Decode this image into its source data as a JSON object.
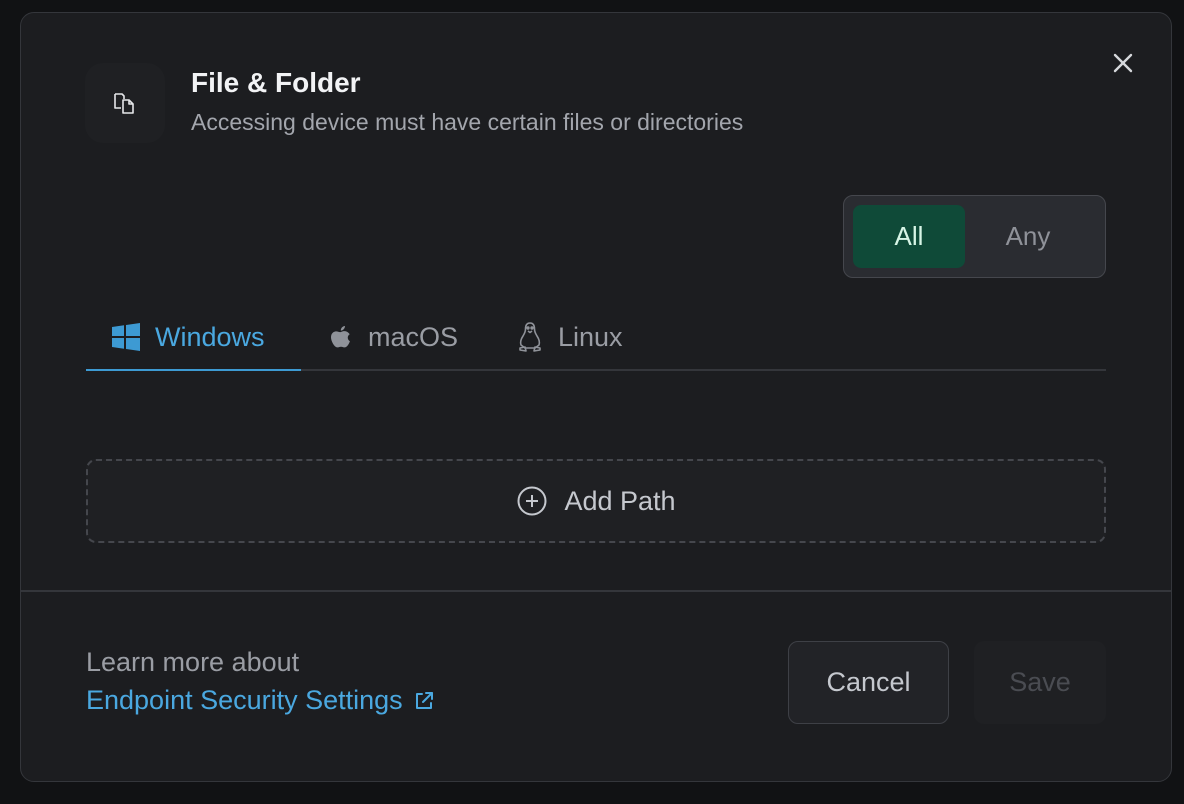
{
  "dialog": {
    "title": "File & Folder",
    "subtitle": "Accessing device must have certain files or directories",
    "header_icon": "file-folder-icon",
    "close_icon": "close-icon"
  },
  "match_toggle": {
    "options": [
      {
        "label": "All",
        "selected": true
      },
      {
        "label": "Any",
        "selected": false
      }
    ]
  },
  "tabs": [
    {
      "label": "Windows",
      "icon": "windows-icon",
      "active": true
    },
    {
      "label": "macOS",
      "icon": "apple-icon",
      "active": false
    },
    {
      "label": "Linux",
      "icon": "linux-icon",
      "active": false
    }
  ],
  "add_path": {
    "label": "Add Path",
    "icon": "plus-circle-icon"
  },
  "footer": {
    "learn_more_text": "Learn more about",
    "link_text": "Endpoint Security Settings",
    "link_icon": "external-link-icon",
    "cancel_label": "Cancel",
    "save_label": "Save",
    "save_disabled": true
  },
  "colors": {
    "accent_blue": "#4aa8e0",
    "toggle_active_bg": "#0f4a38",
    "modal_bg": "#1c1d20"
  }
}
